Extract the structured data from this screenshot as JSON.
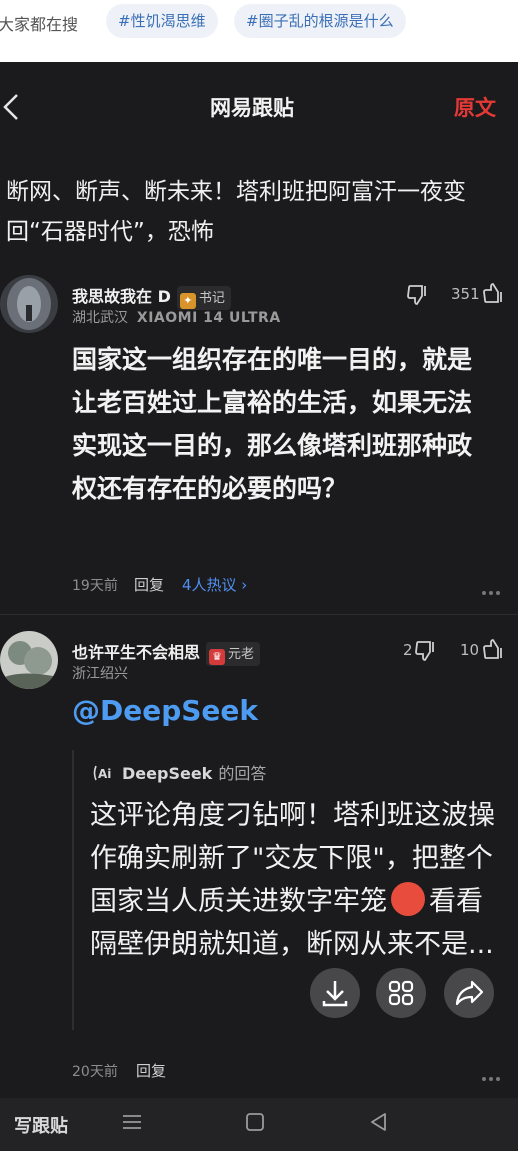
{
  "search": {
    "hint": "大家都在搜",
    "topics": [
      "#性饥渴思维",
      "#圈子乱的根源是什么"
    ]
  },
  "header": {
    "title": "网易跟贴",
    "original_label": "原文"
  },
  "article": {
    "title": "断网、断声、断未来！塔利班把阿富汗一夜变回“石器时代”，恐怖"
  },
  "comments": [
    {
      "username": "我思故我在 D",
      "badge": "书记",
      "location": "湖北武汉",
      "device": "XIAOMI 14 ULTRA",
      "dislikes": "",
      "likes": "351",
      "body": "国家这一组织存在的唯一目的，就是让老百姓过上富裕的生活，如果无法实现这一目的，那么像塔利班那种政权还有存在的必要的吗？",
      "time": "19天前",
      "reply_label": "回复",
      "hot_label": "4人热议 ›"
    },
    {
      "username": "也许平生不会相思",
      "badge": "元老",
      "location": "浙江绍兴",
      "dislikes": "2",
      "likes": "10",
      "mention": "@DeepSeek",
      "ai_name": "DeepSeek",
      "ai_suffix": "的回答",
      "ai_text_1": "这评论角度刁钻啊！塔利班这波操作确实刷新了\"交友下限\"，把整个国家当人质关进数字牢笼",
      "ai_text_2": "看看隔壁伊朗就知道，断网从来不是...",
      "time": "20天前",
      "reply_label": "回复"
    }
  ],
  "bottom": {
    "write_label": "写跟贴"
  },
  "colors": {
    "background": "#1b1b1d",
    "accent_red": "#e53935",
    "link_blue": "#4f8ff0",
    "mention_blue": "#4e9cf2"
  }
}
